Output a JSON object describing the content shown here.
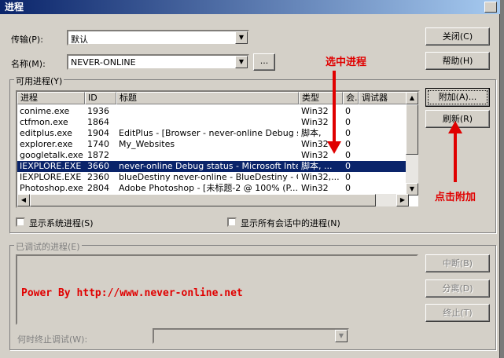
{
  "window": {
    "title": "进程"
  },
  "form": {
    "transport_label": "传输(P):",
    "transport_value": "默认",
    "name_label": "名称(M):",
    "name_value": "NEVER-ONLINE",
    "browse_label": "..."
  },
  "buttons": {
    "close": "关闭(C)",
    "help": "帮助(H)",
    "attach": "附加(A)...",
    "refresh": "刷新(R)",
    "break": "中断(B)",
    "detach": "分离(D)",
    "terminate": "终止(T)"
  },
  "available": {
    "group_title": "可用进程(Y)",
    "columns": [
      "进程",
      "ID",
      "标题",
      "类型",
      "会...",
      "调试器"
    ],
    "rows": [
      {
        "process": "conime.exe",
        "id": "1936",
        "title": "",
        "type": "Win32",
        "session": "0"
      },
      {
        "process": "ctfmon.exe",
        "id": "1864",
        "title": "",
        "type": "Win32",
        "session": "0"
      },
      {
        "process": "editplus.exe",
        "id": "1904",
        "title": "EditPlus - [Browser - never-online Debug st...",
        "type": "脚本,",
        "session": "0"
      },
      {
        "process": "explorer.exe",
        "id": "1740",
        "title": "My_Websites",
        "type": "Win32",
        "session": "0"
      },
      {
        "process": "googletalk.exe",
        "id": "1872",
        "title": "",
        "type": "Win32",
        "session": "0"
      },
      {
        "process": "IEXPLORE.EXE",
        "id": "3660",
        "title": "never-online Debug status - Microsoft Inte...",
        "type": "脚本, ...",
        "session": "0",
        "selected": true
      },
      {
        "process": "IEXPLORE.EXE",
        "id": "2360",
        "title": "blueDestiny never-online - BlueDestiny - C...",
        "type": "Win32,...",
        "session": "0"
      },
      {
        "process": "Photoshop.exe",
        "id": "2804",
        "title": "Adobe Photoshop - [未标题-2 @ 100% (P...",
        "type": "Win32",
        "session": "0"
      }
    ],
    "show_system": "显示系统进程(S)",
    "show_all_sessions": "显示所有会话中的进程(N)"
  },
  "debugged": {
    "group_title": "已调试的进程(E)",
    "when_done_label": "何时终止调试(W):"
  },
  "annotations": {
    "select_process": "选中进程",
    "click_attach": "点击附加",
    "power_by": "Power By http://www.never-online.net"
  },
  "colors": {
    "selection": "#0a246a",
    "annotation": "#e00000",
    "titlebar": "#0a246a"
  }
}
